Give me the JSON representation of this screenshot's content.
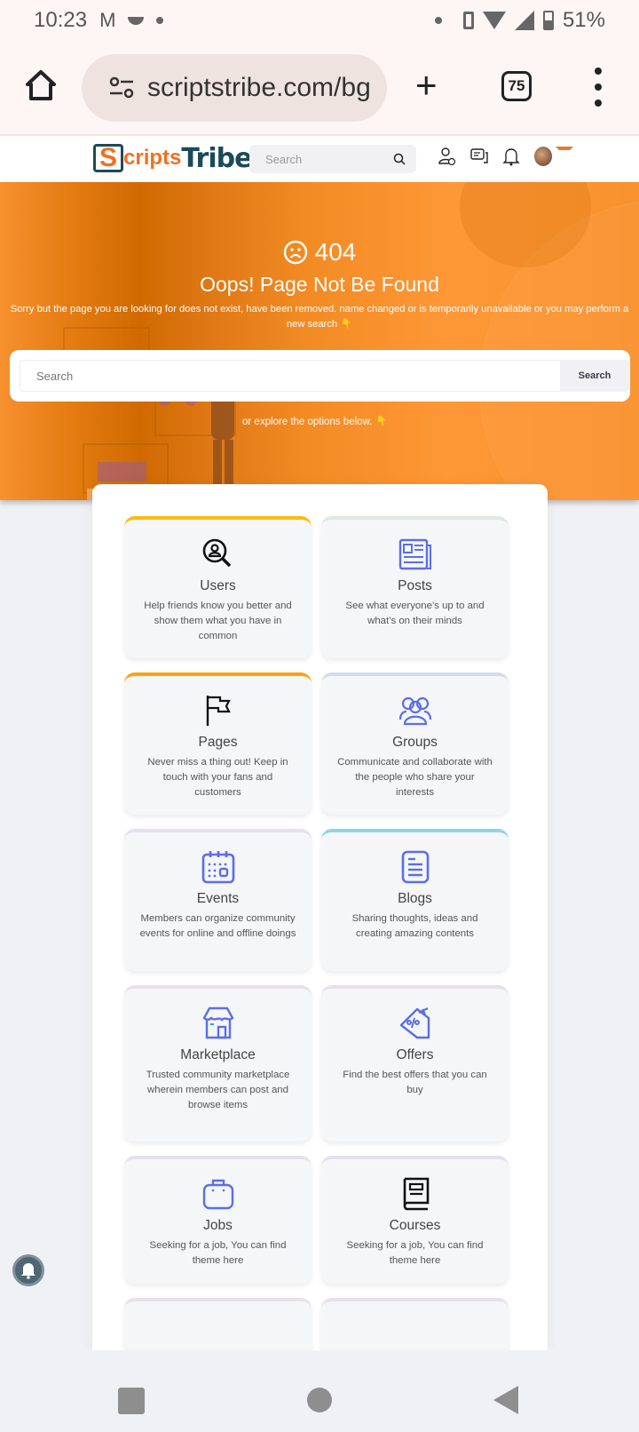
{
  "status_bar": {
    "time": "10:23",
    "battery": "51%",
    "icons": [
      "gmail-icon",
      "moon-icon",
      "dot-icon",
      "dot-icon",
      "vibrate-icon",
      "wifi-icon",
      "signal-icon",
      "battery-icon"
    ]
  },
  "browser": {
    "url": "scriptstribe.com/bg",
    "tab_count": "75"
  },
  "site_header": {
    "logo_s": "S",
    "logo_cripts": "cripts",
    "logo_tribe": "Tribe",
    "search_placeholder": "Search",
    "icons": [
      "add-user-icon",
      "messages-icon",
      "notifications-bell-icon",
      "avatar"
    ]
  },
  "hero": {
    "code": "404",
    "title": "Oops! Page Not Be Found",
    "description": "Sorry but the page you are looking for does not exist, have been removed. name changed or is temporarily unavailable or you may perform a new search 👇",
    "search_placeholder": "Search",
    "search_button": "Search",
    "explore_text": "or explore the options below. 👇",
    "colors": {
      "accent": "#f7902e",
      "dark": "#d06a00"
    }
  },
  "cards": [
    {
      "title": "Users",
      "description": "Help friends know you better and show them what you have in common",
      "icon": "user-search-icon",
      "accent": "#fdbb11"
    },
    {
      "title": "Posts",
      "description": "See what everyone’s up to and what’s on their minds",
      "icon": "newspaper-icon",
      "accent": "#dfe8e2"
    },
    {
      "title": "Pages",
      "description": "Never miss a thing out! Keep in touch with your fans and customers",
      "icon": "flag-icon",
      "accent": "#fca311"
    },
    {
      "title": "Groups",
      "description": "Communicate and collaborate with the people who share your interests",
      "icon": "group-icon",
      "accent": "#cfdfe8"
    },
    {
      "title": "Events",
      "description": "Members can organize community events for online and offline doings",
      "icon": "calendar-icon",
      "accent": "#e8e0ec"
    },
    {
      "title": "Blogs",
      "description": "Sharing thoughts, ideas and creating amazing contents",
      "icon": "document-icon",
      "accent": "#8ed4e6"
    },
    {
      "title": "Marketplace",
      "description": "Trusted community marketplace wherein members can post and browse items",
      "icon": "store-icon",
      "accent": "#e8e0ec"
    },
    {
      "title": "Offers",
      "description": "Find the best offers that you can buy",
      "icon": "discount-tag-icon",
      "accent": "#e8e0ec"
    },
    {
      "title": "Jobs",
      "description": "Seeking for a job, You can find theme here",
      "icon": "briefcase-icon",
      "accent": "#e8e0ec"
    },
    {
      "title": "Courses",
      "description": "Seeking for a job, You can find theme here",
      "icon": "book-icon",
      "accent": "#e8e0ec"
    }
  ],
  "icon_color": "#5b6ee8"
}
